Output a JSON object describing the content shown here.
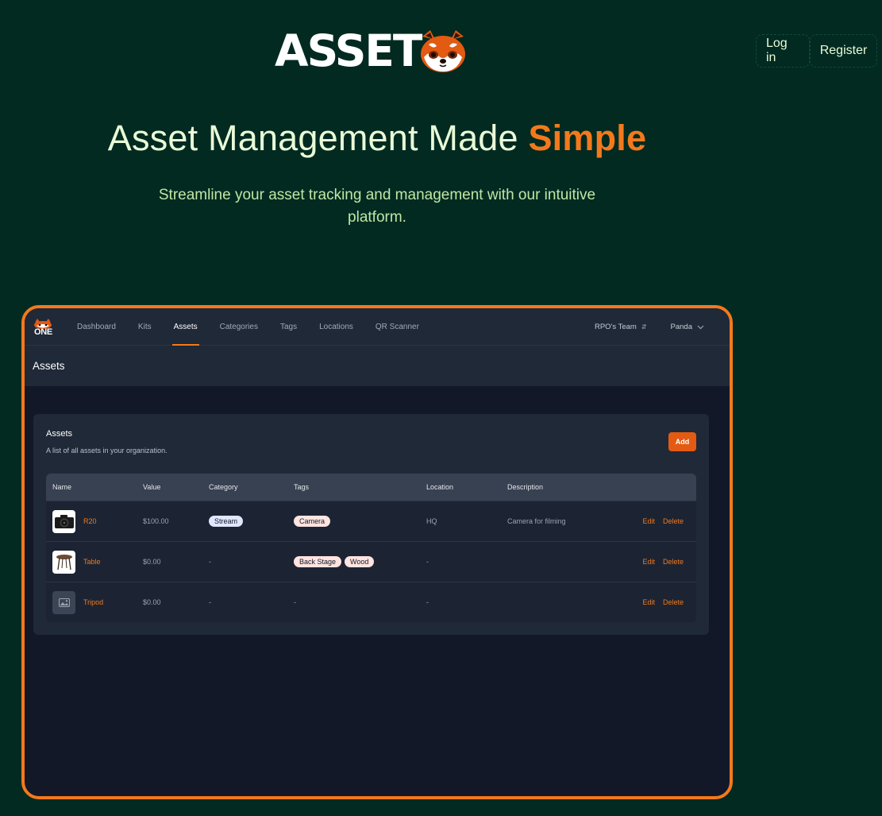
{
  "brand": {
    "name": "ASSET",
    "accent": "#f3791c",
    "background": "#022a21"
  },
  "auth": {
    "login": "Log in",
    "register": "Register"
  },
  "hero": {
    "title": "Asset Management Made",
    "title_accent": "Simple",
    "subtitle": "Streamline your asset tracking and management with our intuitive platform."
  },
  "app": {
    "logo_text": "ONE",
    "nav": [
      "Dashboard",
      "Kits",
      "Assets",
      "Categories",
      "Tags",
      "Locations",
      "QR Scanner"
    ],
    "active_nav": "Assets",
    "team": "RPO's Team",
    "user": "Panda",
    "page_title": "Assets",
    "card": {
      "title": "Assets",
      "description": "A list of all assets in your organization.",
      "add_label": "Add"
    },
    "table": {
      "headers": [
        "Name",
        "Value",
        "Category",
        "Tags",
        "Location",
        "Description"
      ],
      "rows": [
        {
          "name": "R20",
          "value": "$100.00",
          "category": "Stream",
          "tags": [
            "Camera"
          ],
          "location": "HQ",
          "description": "Camera for filming",
          "thumb": "camera-thumbnail",
          "edit": "Edit",
          "delete": "Delete"
        },
        {
          "name": "Table",
          "value": "$0.00",
          "category": "-",
          "tags": [
            "Back Stage",
            "Wood"
          ],
          "location": "-",
          "description": "",
          "thumb": "table-thumbnail",
          "edit": "Edit",
          "delete": "Delete"
        },
        {
          "name": "Tripod",
          "value": "$0.00",
          "category": "-",
          "tags": "-",
          "location": "-",
          "description": "",
          "thumb": "image-placeholder-icon",
          "edit": "Edit",
          "delete": "Delete"
        }
      ]
    }
  }
}
